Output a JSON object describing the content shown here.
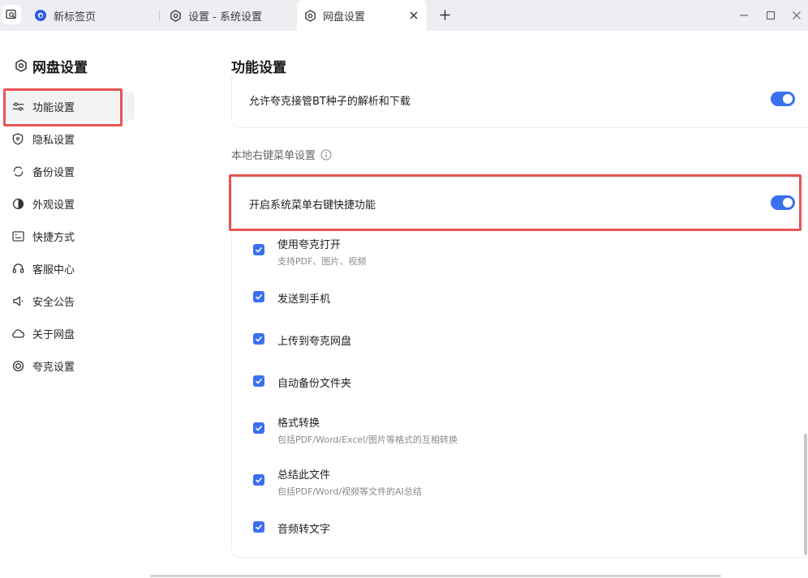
{
  "tabs": [
    {
      "label": "新标签页",
      "icon": "browser-logo-icon"
    },
    {
      "label": "设置 - 系统设置",
      "icon": "settings-icon"
    },
    {
      "label": "网盘设置",
      "icon": "settings-icon",
      "active": true
    }
  ],
  "sidebar": {
    "title": "网盘设置",
    "items": [
      {
        "label": "功能设置",
        "icon": "sliders-icon",
        "active": true
      },
      {
        "label": "隐私设置",
        "icon": "shield-icon"
      },
      {
        "label": "备份设置",
        "icon": "sync-icon"
      },
      {
        "label": "外观设置",
        "icon": "contrast-icon"
      },
      {
        "label": "快捷方式",
        "icon": "keyboard-icon"
      },
      {
        "label": "客服中心",
        "icon": "headset-icon"
      },
      {
        "label": "安全公告",
        "icon": "speaker-icon"
      },
      {
        "label": "关于网盘",
        "icon": "cloud-icon"
      },
      {
        "label": "夸克设置",
        "icon": "quark-icon"
      }
    ]
  },
  "main": {
    "title": "功能设置",
    "bt_option": {
      "label": "允许夸克接管BT种子的解析和下载",
      "enabled": true
    },
    "section_label": "本地右键菜单设置",
    "context_menu_toggle": {
      "label": "开启系统菜单右键快捷功能",
      "enabled": true
    },
    "options": [
      {
        "title": "使用夸克打开",
        "desc": "支持PDF、图片、视频",
        "checked": true
      },
      {
        "title": "发送到手机",
        "desc": "",
        "checked": true
      },
      {
        "title": "上传到夸克网盘",
        "desc": "",
        "checked": true
      },
      {
        "title": "自动备份文件夹",
        "desc": "",
        "checked": true
      },
      {
        "title": "格式转换",
        "desc": "包括PDF/Word/Excel/图片等格式的互相转换",
        "checked": true
      },
      {
        "title": "总结此文件",
        "desc": "包括PDF/Word/视频等文件的AI总结",
        "checked": true
      },
      {
        "title": "音频转文字",
        "desc": "",
        "checked": true
      }
    ]
  },
  "colors": {
    "accent": "#3b6ff0",
    "highlight": "#e85454"
  }
}
